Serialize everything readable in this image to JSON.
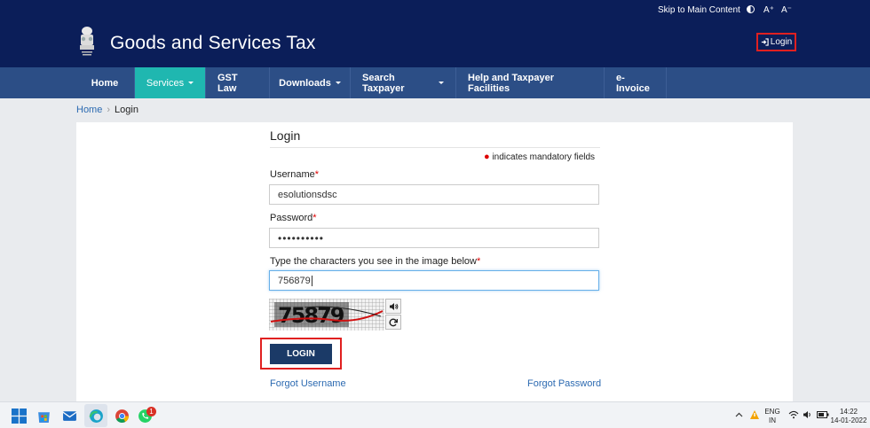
{
  "topbar": {
    "skip": "Skip to Main Content",
    "a_plus": "A⁺",
    "a_minus": "A⁻"
  },
  "header": {
    "title": "Goods and Services Tax",
    "login": "Login"
  },
  "nav": [
    {
      "label": "Home",
      "dropdown": false,
      "active": false
    },
    {
      "label": "Services",
      "dropdown": true,
      "active": true
    },
    {
      "label": "GST Law",
      "dropdown": false,
      "active": false
    },
    {
      "label": "Downloads",
      "dropdown": true,
      "active": false
    },
    {
      "label": "Search Taxpayer",
      "dropdown": true,
      "active": false
    },
    {
      "label": "Help and Taxpayer Facilities",
      "dropdown": false,
      "active": false
    },
    {
      "label": "e-Invoice",
      "dropdown": false,
      "active": false
    }
  ],
  "breadcrumb": {
    "home": "Home",
    "separator": "›",
    "current": "Login"
  },
  "form": {
    "title": "Login",
    "mandatory_note": "indicates mandatory fields",
    "username_label": "Username",
    "username_value": "esolutionsdsc",
    "password_label": "Password",
    "password_value": "••••••••••",
    "captcha_label": "Type the characters you see in the image below",
    "captcha_value": "756879",
    "asterisk": "*",
    "login_button": "LOGIN",
    "forgot_username": "Forgot Username",
    "forgot_password": "Forgot Password"
  },
  "taskbar": {
    "whatsapp_badge": "1",
    "lang_top": "ENG",
    "lang_bottom": "IN",
    "time": "14:22",
    "date": "14-01-2022"
  },
  "colors": {
    "header_bg": "#0b1e59",
    "nav_bg": "#2c4e86",
    "active_tab": "#1fb7b0",
    "button": "#1b3a67",
    "highlight": "#e02020",
    "link": "#2c6ab1"
  }
}
